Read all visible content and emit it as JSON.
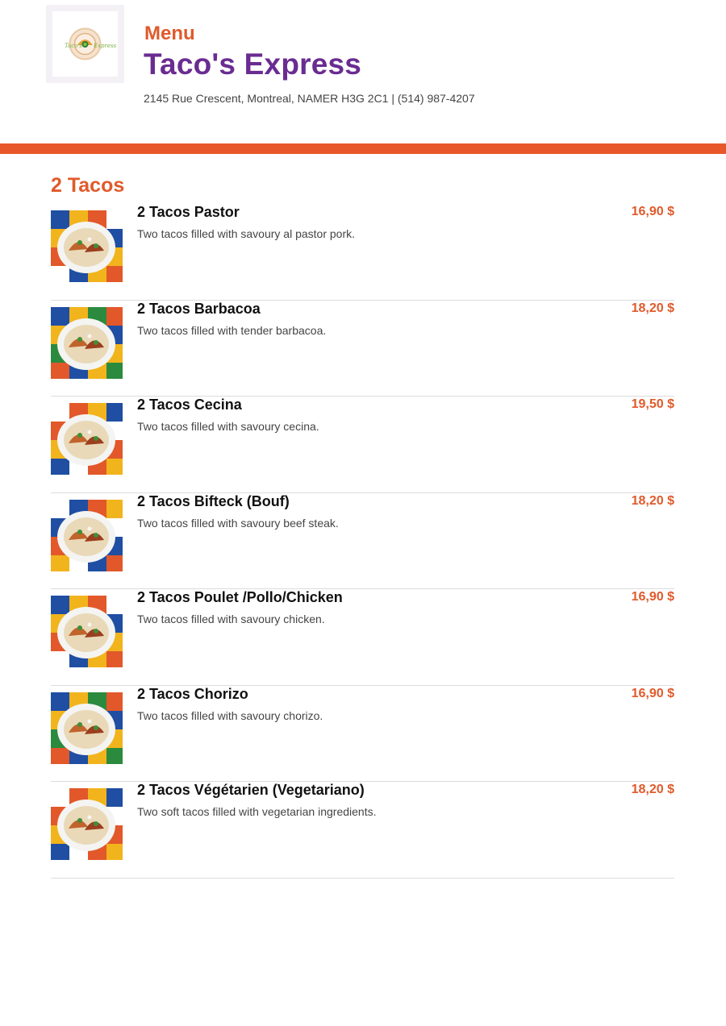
{
  "header": {
    "logo_text_left": "Taco's",
    "logo_text_right": "Express",
    "menu_label": "Menu",
    "restaurant_name": "Taco's Express",
    "address": "2145 Rue Crescent, Montreal, NAMER H3G 2C1 | (514) 987-4207"
  },
  "colors": {
    "accent_orange": "#e8572a",
    "brand_purple": "#6a2c91",
    "price_orange": "#e05a2b"
  },
  "section": {
    "title": "2 Tacos",
    "items": [
      {
        "name": "2 Tacos Pastor",
        "description": "Two tacos filled with savoury al pastor pork.",
        "price": "16,90 $"
      },
      {
        "name": "2 Tacos Barbacoa",
        "description": "Two tacos filled with tender barbacoa.",
        "price": "18,20 $"
      },
      {
        "name": "2 Tacos Cecina",
        "description": "Two tacos filled with savoury cecina.",
        "price": "19,50 $"
      },
      {
        "name": "2 Tacos Bifteck (Bouf)",
        "description": "Two tacos filled with savoury beef steak.",
        "price": "18,20 $"
      },
      {
        "name": "2 Tacos Poulet /Pollo/Chicken",
        "description": "Two tacos filled with savoury chicken.",
        "price": "16,90 $"
      },
      {
        "name": "2 Tacos Chorizo",
        "description": "Two tacos filled with savoury chorizo.",
        "price": "16,90 $"
      },
      {
        "name": "2 Tacos Végétarien (Vegetariano)",
        "description": "Two soft tacos filled with vegetarian ingredients.",
        "price": "18,20 $"
      }
    ]
  }
}
